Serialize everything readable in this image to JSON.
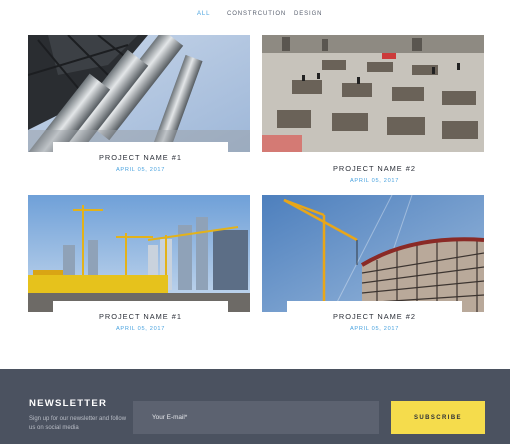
{
  "filters": [
    {
      "label": "ALL",
      "active": true
    },
    {
      "label": "CONSTRCUTION",
      "active": false
    },
    {
      "label": "DESIGN",
      "active": false
    }
  ],
  "projects": [
    {
      "title": "PROJECT NAME #1",
      "date": "APRIL 05, 2017"
    },
    {
      "title": "PROJECT NAME #2",
      "date": "APRIL 05, 2017"
    },
    {
      "title": "PROJECT NAME #1",
      "date": "APRIL 05, 2017"
    },
    {
      "title": "PROJECT NAME #2",
      "date": "APRIL 05, 2017"
    }
  ],
  "newsletter": {
    "title": "NEWSLETTER",
    "description": "Sign up for our newsletter and follow us on social media",
    "email_placeholder": "Your E-mail*",
    "email_value": "",
    "subscribe_label": "SUBSCRIBE"
  },
  "colors": {
    "accent": "#4aa3df",
    "footer_bg": "#4b5260",
    "input_bg": "#5c6270",
    "button_bg": "#f5dc4c"
  }
}
